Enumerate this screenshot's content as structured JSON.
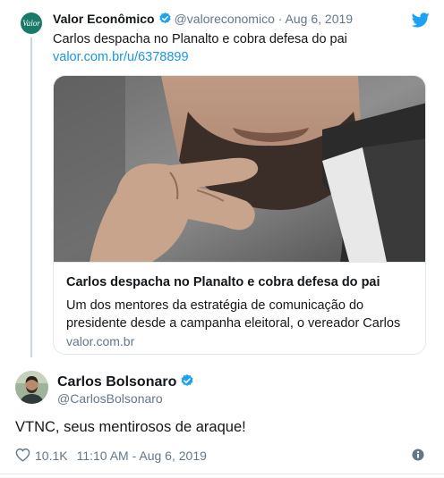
{
  "quoted": {
    "avatar_text": "Valor",
    "name": "Valor Econômico",
    "handle": "@valoreconomico",
    "separator": "·",
    "date": "Aug 6, 2019",
    "text": "Carlos despacha no Planalto e cobra defesa do pai",
    "link": "valor.com.br/u/6378899",
    "card": {
      "title": "Carlos despacha no Planalto e cobra defesa do pai",
      "description": "Um dos mentores da estratégia de comunicação do presidente desde a campanha eleitoral, o vereador Carlos",
      "domain": "valor.com.br"
    }
  },
  "tweet": {
    "name": "Carlos Bolsonaro",
    "handle": "@CarlosBolsonaro",
    "text": "VTNC, seus mentirosos de araque!",
    "likes": "10.1K",
    "timestamp": "11:10 AM - Aug 6, 2019"
  },
  "colors": {
    "link": "#1b95e0",
    "verified": "#1da1f2",
    "muted": "#657786",
    "brand_valor": "#1a7a6a"
  },
  "icons": [
    "verified-badge-icon",
    "twitter-bird-icon",
    "heart-icon",
    "info-icon"
  ]
}
